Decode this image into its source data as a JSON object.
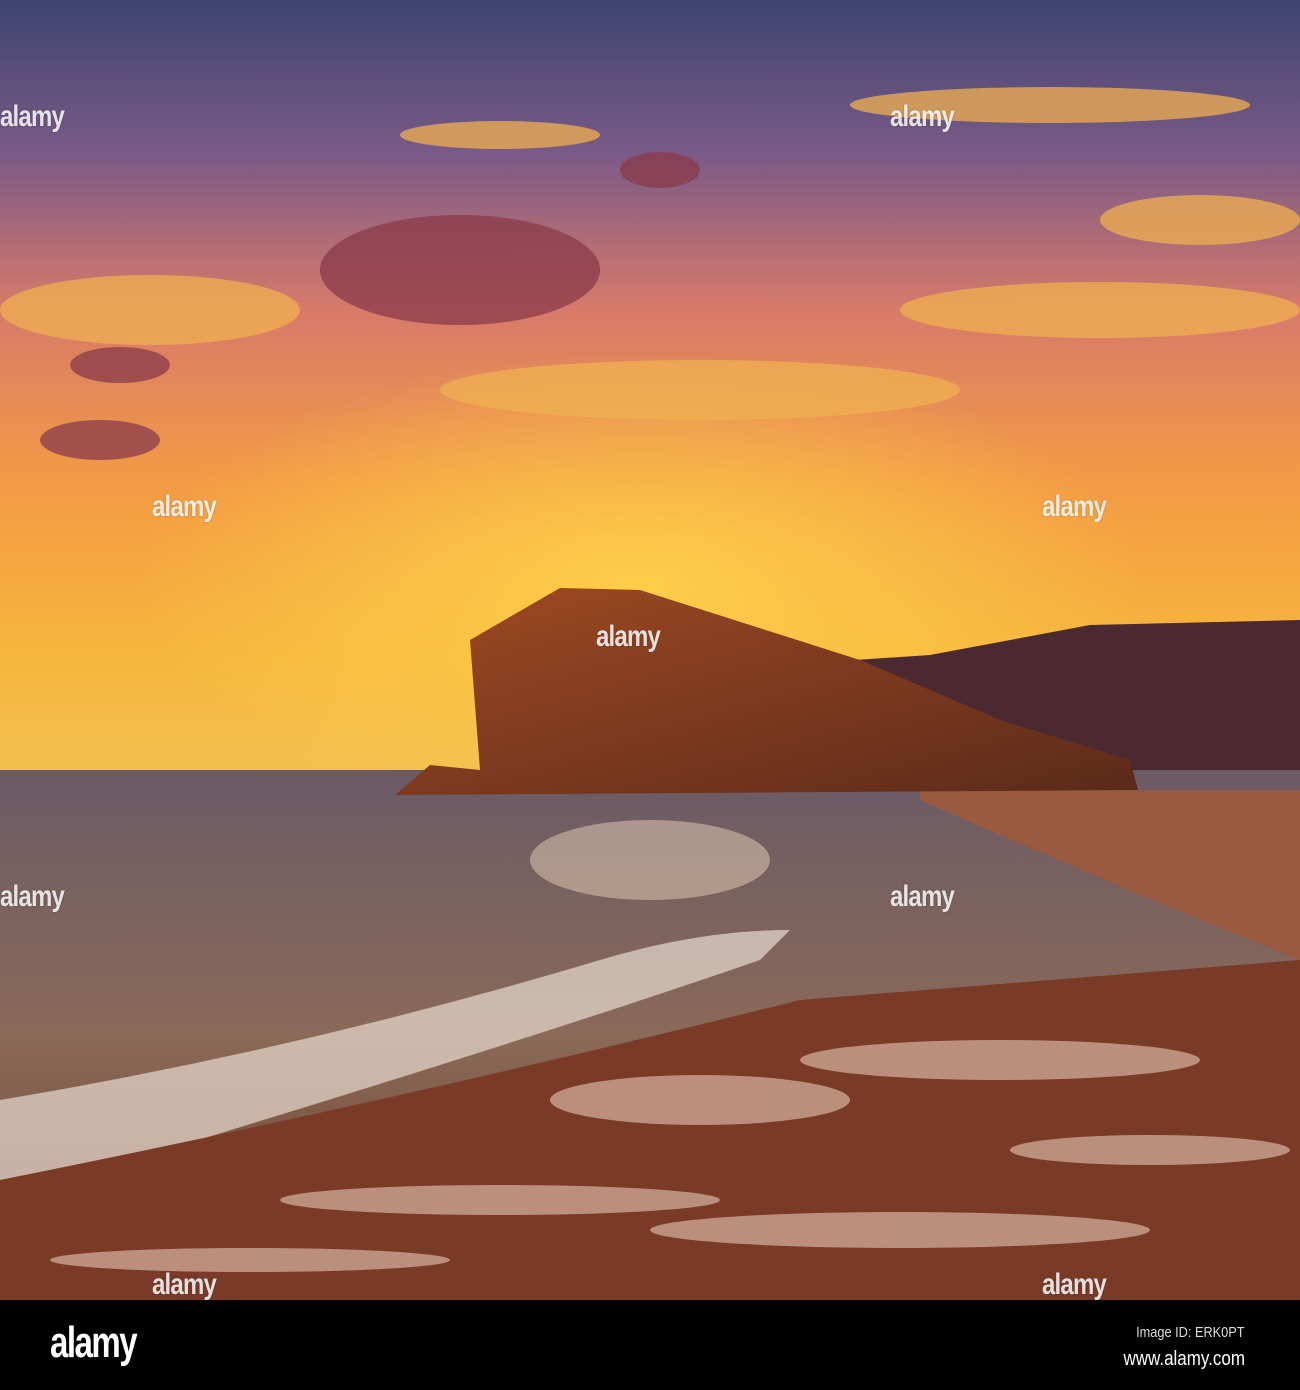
{
  "photo": {
    "colors": {
      "sky_top": "#3e4470",
      "sky_mid": "#e07a52",
      "horizon": "#f6b73a",
      "rock": "#7a3a1e",
      "sea": "#5b4a55",
      "sand": "#7b3c28"
    }
  },
  "watermark": {
    "text": "alamy"
  },
  "footer": {
    "logo": "alamy",
    "image_id": "Image ID: ERK0PT",
    "website": "www.alamy.com"
  }
}
